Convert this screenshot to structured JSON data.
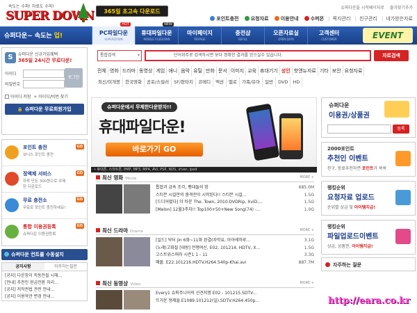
{
  "header": {
    "logo_sub": "속도는 수퍼! 자료도 수퍼!",
    "logo": "SUPER DOWN",
    "badge": "365일 초고속 다운로드",
    "util": [
      "슈퍼다운을 시작페이지로",
      "즐겨찾기추가"
    ],
    "links": [
      "포인트충전",
      "요청자료",
      "이용안내",
      "수퍼몬",
      "쪽지관리",
      "친구관리",
      "내가받은자료"
    ]
  },
  "nav": {
    "slogan_prefix": "슈퍼다운~ 속도는 ",
    "slogan_em": "업!",
    "items": [
      {
        "label": "PC파일다운",
        "sub": "SUPERDOWN",
        "tag": "HOT"
      },
      {
        "label": "휴대파일다운",
        "sub": "MOBILE FILEDOWN",
        "tag": "NEW"
      },
      {
        "label": "마이페이지",
        "sub": "MYPAGE",
        "tag": ""
      },
      {
        "label": "충전샵",
        "sub": "REFILL",
        "tag": ""
      },
      {
        "label": "오픈자료실",
        "sub": "OPEN DATA",
        "tag": ""
      },
      {
        "label": "고객센터",
        "sub": "CUSTOMER",
        "tag": ""
      }
    ],
    "event": "EVENT"
  },
  "search": {
    "select": "통합검색",
    "placeholder": "단어위주로 검색하시면 보다 정확한 결과를 얻으실수 있습니다.",
    "button": "자료검색"
  },
  "categories": {
    "row1": [
      "전체",
      "영화",
      "드라마",
      "동영상",
      "게임",
      "애니",
      "음악",
      "유틸",
      "만화",
      "문서",
      "이미지",
      "교육",
      "휴대기기",
      "성인",
      "핫앤뉴자료",
      "기타",
      "보안",
      "요청자료"
    ],
    "hot_index": 13,
    "row2": [
      "최신/미개봉",
      "한국영화",
      "공포/스릴러",
      "SF/판타지",
      "코메디",
      "액션",
      "멜로",
      "가족/유아",
      "일반",
      "DVD",
      "HD"
    ]
  },
  "login": {
    "line1": "슈퍼다운 신규가입혜택",
    "line2": "365일 24시간 무료다운!",
    "id_label": "아이디",
    "pw_label": "비밀번호",
    "login_btn": "로그인",
    "save_id": "아이디 저장",
    "find": "+ 아이디/비번 찾기",
    "join_btn": "슈퍼다운 무료회원가입"
  },
  "services": [
    {
      "title": "포인트 충전",
      "desc": "보너스 포인트 충전",
      "color": "#f0a020",
      "title_red": false
    },
    {
      "title": "정액제 서비스",
      "desc": "하루 단돈 300원으로 무제한 다운로드",
      "color": "#e04a2a",
      "title_red": false
    },
    {
      "title": "무료 충전소",
      "desc": "무료로 포인트 충전하세요!",
      "color": "#3a8ad8",
      "title_red": false
    },
    {
      "title": "통합 이용권등록",
      "desc": "슈퍼다운 이용권등록",
      "color": "#6ab040",
      "title_red": true
    }
  ],
  "go_label": "GO",
  "remote": "슈퍼다운 컨트롤 수동설치",
  "notice": {
    "tabs": [
      "공지사항",
      "자주하는질문"
    ],
    "items": [
      "[공지] 다운창이 작동안될 시해...",
      "[안내] 추천인 현금전환 처리...",
      "[공지] 저작권법 관련 안내...",
      "[공지] 이용약관 변경 안내..."
    ]
  },
  "banner": {
    "pill": "슈퍼다운에서 무제한다운받자!!",
    "main": "휴대파일다운!",
    "button": "바로가기 GO",
    "formats": "• 휴대폰, 스마트폰, PMP, MP3, MP4, AVI, PSP, NDS, iriver, ipod"
  },
  "sections": [
    {
      "title": "최신 영화",
      "sub": "Movie",
      "rows": [
        {
          "t": "톱밥과 금속 조각, 팽대들의 밤",
          "s": "685.0M"
        },
        {
          "t": "스티븐 시걸만의 충격전이 시작된다!! 스티븐 시걸...",
          "s": "1.5G"
        },
        {
          "t": "[드디어떴다] 더 타운 The. Town, 2010.DVDRip, XviD,...",
          "s": "1.5G"
        },
        {
          "t": "[Melon] 12월3주차!! Top100+50+New Song(74) -...",
          "s": "1.0G"
        }
      ]
    },
    {
      "title": "최신 드라마",
      "sub": "Drama",
      "rows": [
        {
          "t": "[일드] 닥터 jin 6화~11화 완결(자막유, 아야세하루...",
          "s": "3.1G"
        },
        {
          "t": "(노래)고화질 [대왕] 전쟁여신, E02, 101214, HDTV, X...",
          "s": "1.5G"
        },
        {
          "t": "고스트위스퍼러 시즌1 1 - 11",
          "s": "3.3G"
        },
        {
          "t": "매몰. E22.101216.HDTV.H264.540p-Khai.avi",
          "s": "887.7M"
        }
      ]
    },
    {
      "title": "최신 동영상",
      "sub": "Video",
      "rows": [
        {
          "t": "Every1 슈퍼주니어의 선견지명 E02 - 101215.SDTV...",
          "s": ""
        },
        {
          "t": "뜨거운 형제들.E1089.101212(일).SDTV.H264.450p...",
          "s": ""
        }
      ]
    }
  ],
  "more_label": "MORE +",
  "coupon": {
    "t1": "슈퍼다운",
    "t2": "이용권/상품권",
    "btn": "등록"
  },
  "promos": [
    {
      "t1": "2000포인트",
      "t2": "추천인 이벤트",
      "t3_pre": "친구, 동료추천하면 ",
      "t3_em": "포인트",
      "t3_post": "가 쑥쑥",
      "color": "#ff9a2a"
    },
    {
      "t1": "랭킹순위",
      "t2": "요청자료 업로드",
      "t3_pre": "순위별 상금 및 ",
      "t3_em": "아이템지급!",
      "t3_post": "",
      "color": "#4a9ad8"
    },
    {
      "t1": "랭킹순위",
      "t2": "파일업로드이벤트",
      "t3_pre": "상금, 상품권, ",
      "t3_em": "아이템지급!",
      "t3_post": "",
      "color": "#e24a8a"
    }
  ],
  "faq": "자주하는 질문",
  "watermark": "http://eara.co.kr"
}
